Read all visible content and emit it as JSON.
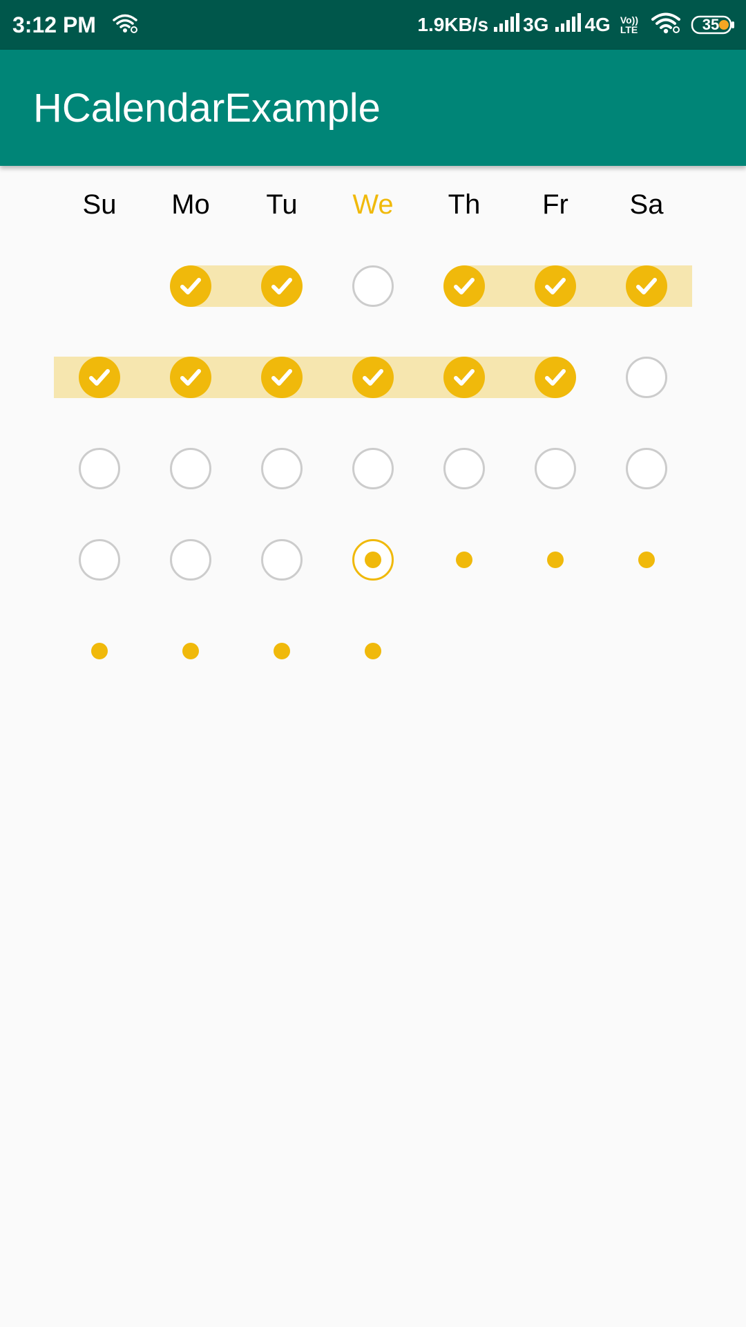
{
  "status_bar": {
    "time": "3:12 PM",
    "net_speed": "1.9KB/s",
    "sim1_type": "3G",
    "sim2_type": "4G",
    "volte_top": "Vo))",
    "volte_bottom": "LTE",
    "battery": "35",
    "icons": [
      "wifi-hotspot-icon",
      "signal-bars-icon",
      "volte-icon",
      "wifi-icon",
      "battery-icon"
    ]
  },
  "app_bar": {
    "title": "HCalendarExample"
  },
  "calendar": {
    "weekdays": [
      "Su",
      "Mo",
      "Tu",
      "We",
      "Th",
      "Fr",
      "Sa"
    ],
    "today_column": 3,
    "colors": {
      "accent": "#f0b90b",
      "band": "#f6e6af",
      "empty_ring": "#cccccc",
      "appbar": "#008577",
      "statusbar": "#00574b"
    },
    "weeks": [
      [
        "blank",
        "checked",
        "checked",
        "empty",
        "checked",
        "checked",
        "checked"
      ],
      [
        "checked",
        "checked",
        "checked",
        "checked",
        "checked",
        "checked",
        "empty"
      ],
      [
        "empty",
        "empty",
        "empty",
        "empty",
        "empty",
        "empty",
        "empty"
      ],
      [
        "empty",
        "empty",
        "empty",
        "today",
        "dot",
        "dot",
        "dot"
      ],
      [
        "dot",
        "dot",
        "dot",
        "dot",
        "blank",
        "blank",
        "blank"
      ]
    ]
  }
}
